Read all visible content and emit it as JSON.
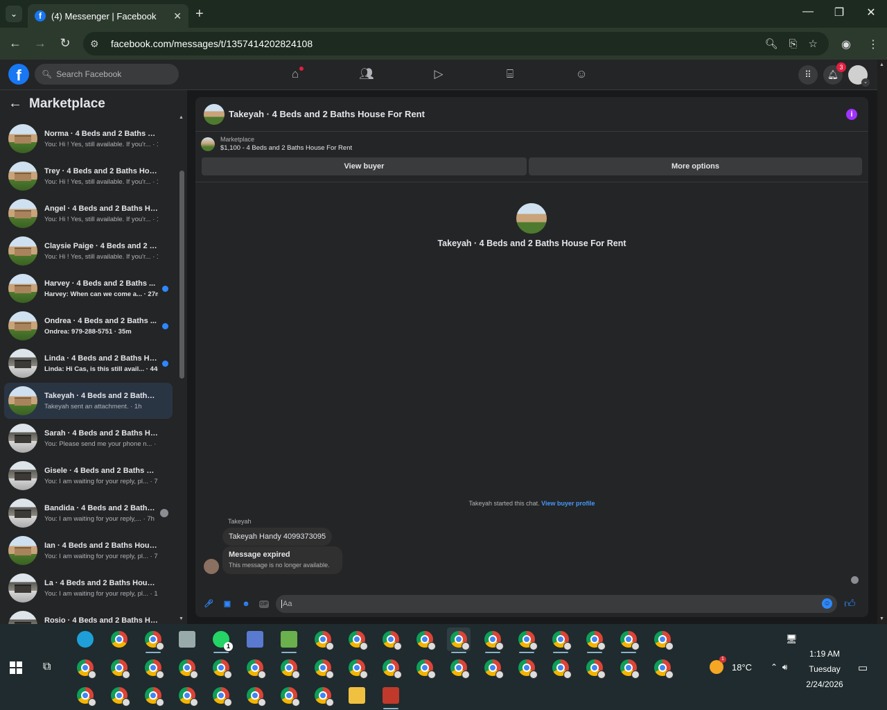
{
  "browser": {
    "tab_title": "(4) Messenger | Facebook",
    "tab_favicon": "facebook-icon",
    "url": "facebook.com/messages/t/1357414202824108",
    "new_tab_label": "+",
    "close_tab_label": "✕",
    "window_controls": [
      "—",
      "❐",
      "✕"
    ]
  },
  "fb_nav": {
    "search_placeholder": "Search Facebook",
    "logo_letter": "f",
    "notification_count": "3",
    "icons": [
      "home-icon",
      "friends-icon",
      "watch-icon",
      "marketplace-icon",
      "groups-icon"
    ]
  },
  "sidebar": {
    "title": "Marketplace",
    "conversations": [
      {
        "name": "Norma · 4 Beds and 2 Baths Ho...",
        "preview": "You: Hi ! Yes, still available. If you'r... · 1m",
        "unread": false
      },
      {
        "name": "Trey · 4 Beds and 2 Baths Hous...",
        "preview": "You: Hi ! Yes, still available. If you'r... · 1m",
        "unread": false
      },
      {
        "name": "Angel · 4 Beds and 2 Baths Hou...",
        "preview": "You: Hi ! Yes, still available. If you'r... · 1m",
        "unread": false
      },
      {
        "name": "Claysie Paige · 4 Beds and 2 Bat...",
        "preview": "You: Hi ! Yes, still available. If you'r... · 1m",
        "unread": false
      },
      {
        "name": "Harvey · 4 Beds and 2 Baths ...",
        "preview": "Harvey: When can we come a... · 27m",
        "unread": true
      },
      {
        "name": "Ondrea · 4 Beds and 2 Baths ...",
        "preview": "Ondrea: 979-288-5751 · 35m",
        "unread": true
      },
      {
        "name": "Linda · 4 Beds and 2 Baths Ho...",
        "preview": "Linda: Hi Cas, is this still avail... · 44m",
        "unread": true
      },
      {
        "name": "Takeyah · 4 Beds and 2 Baths H...",
        "preview": "Takeyah sent an attachment. · 1h",
        "unread": false
      },
      {
        "name": "Sarah · 4 Beds and 2 Baths Hou...",
        "preview": "You: Please send me your phone n... · 4h",
        "unread": false
      },
      {
        "name": "Gisele · 4 Beds and 2 Baths Hou...",
        "preview": "You: I am waiting for your reply, pl... · 7h",
        "unread": false
      },
      {
        "name": "Bandida · 4 Beds and 2 Baths...",
        "preview": "You: I am waiting for your reply,... · 7h",
        "unread": false
      },
      {
        "name": "Ian · 4 Beds and 2 Baths House ...",
        "preview": "You: I am waiting for your reply, pl... · 7h",
        "unread": false
      },
      {
        "name": "La · 4 Beds and 2 Baths House F...",
        "preview": "You: I am waiting for your reply, pl... · 1d",
        "unread": false
      },
      {
        "name": "Rosio · 4 Beds and 2 Baths Hou...",
        "preview": "You: I am waiting for your reply, pl... · 1d",
        "unread": false
      }
    ]
  },
  "chat": {
    "header_title": "Takeyah · 4 Beds and 2 Baths House For Rent",
    "listing_source": "Marketplace",
    "listing_title": "$1,100 - 4 Beds and 2 Baths House For Rent",
    "view_buyer": "View buyer",
    "more_options": "More options",
    "profile_name": "Takeyah · 4 Beds and 2 Baths House For Rent",
    "started_text": "Takeyah started this chat.",
    "view_buyer_profile": "View buyer profile",
    "sender_name": "Takeyah",
    "message1": "Takeyah Handy 4099373095",
    "expired_title": "Message expired",
    "expired_sub": "This message is no longer available.",
    "input_placeholder": "Aa"
  },
  "taskbar": {
    "weather_temp": "18°C",
    "weather_badge": "1",
    "time": "1:19 AM",
    "day": "Tuesday",
    "date": "2/24/2026",
    "whatsapp_badge": "1"
  }
}
